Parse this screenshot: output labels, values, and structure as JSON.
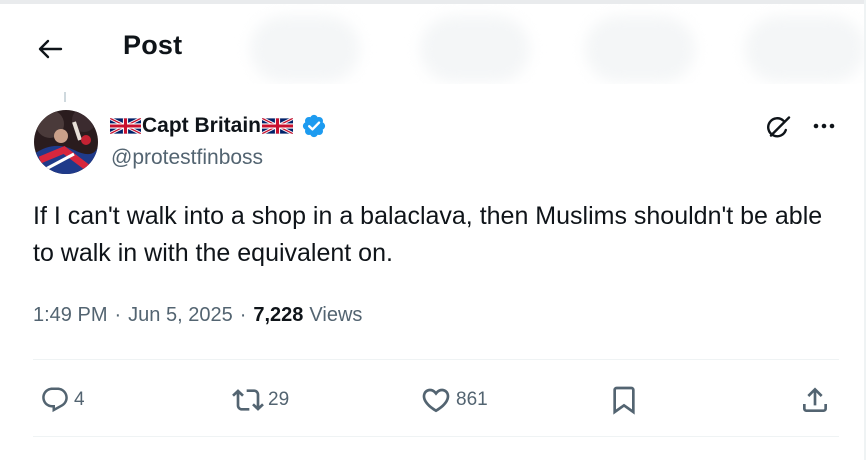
{
  "header": {
    "title": "Post",
    "back_icon": "arrow-left-icon"
  },
  "author": {
    "display_name": "Capt Britain",
    "handle": "@protestfinboss",
    "verified": true,
    "flag_icon": "union-jack-flag-icon",
    "verified_color": "#1d9bf0"
  },
  "tweet": {
    "text": "If I can't walk into a shop in a balaclava, then Muslims shouldn't be able to walk in with the equivalent on.",
    "time": "1:49 PM",
    "date": "Jun 5, 2025",
    "views_count": "7,228",
    "views_label": "Views",
    "separator": "·"
  },
  "actions": {
    "replies": "4",
    "reposts": "29",
    "likes": "861"
  },
  "colors": {
    "text": "#0f1419",
    "muted": "#536471",
    "accent": "#1d9bf0",
    "divider": "#eff3f4"
  }
}
